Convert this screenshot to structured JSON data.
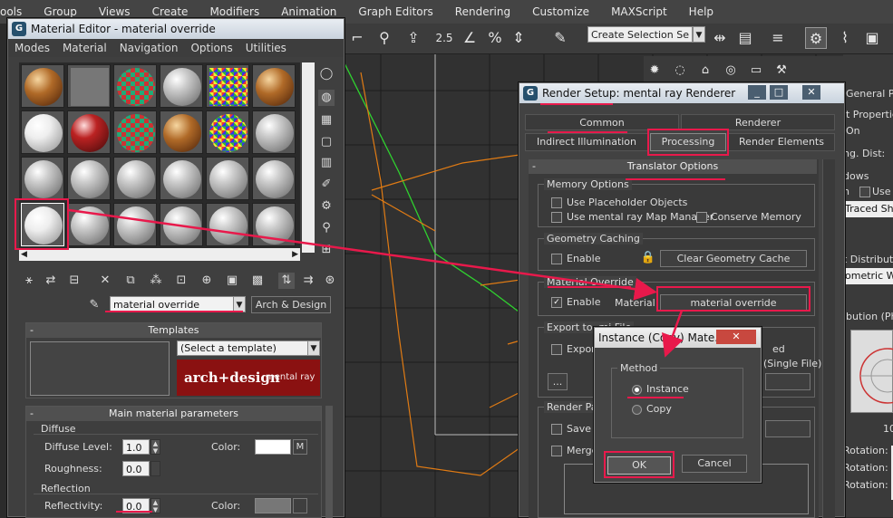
{
  "menubar": {
    "items": [
      "ools",
      "Group",
      "Views",
      "Create",
      "Modifiers",
      "Animation",
      "Graph Editors",
      "Rendering",
      "Customize",
      "MAXScript",
      "Help"
    ]
  },
  "toolbar": {
    "spinner_value": "2.5",
    "selection_set_placeholder": "Create Selection Se"
  },
  "material_editor": {
    "title": "Material Editor - material override",
    "menu": [
      "Modes",
      "Material",
      "Navigation",
      "Options",
      "Utilities"
    ],
    "material_name": "material override",
    "material_type": "Arch & Design",
    "templates": {
      "header": "Templates",
      "select": "(Select a template)",
      "logo_main": "arch+design",
      "logo_sub": "mental ray"
    },
    "main_params": {
      "header": "Main material parameters",
      "diffuse": {
        "title": "Diffuse",
        "level_label": "Diffuse Level:",
        "level_value": "1.0",
        "roughness_label": "Roughness:",
        "roughness_value": "0.0",
        "color_label": "Color:",
        "map_button": "M"
      },
      "reflection": {
        "title": "Reflection",
        "reflectivity_label": "Reflectivity:",
        "reflectivity_value": "0.0",
        "color_label": "Color:"
      }
    }
  },
  "render_setup": {
    "title": "Render Setup: mental ray Renderer",
    "tabs_row1": [
      "Common",
      "Renderer"
    ],
    "tabs_row2": [
      "Indirect Illumination",
      "Processing",
      "Render Elements"
    ],
    "rollout_title": "Translator Options",
    "memory_options": {
      "title": "Memory Options",
      "use_placeholder": "Use Placeholder Objects",
      "use_map_manager": "Use mental ray Map Manager",
      "conserve_memory": "Conserve Memory"
    },
    "geometry_caching": {
      "title": "Geometry Caching",
      "enable": "Enable",
      "clear_button": "Clear Geometry Cache"
    },
    "material_override": {
      "title": "Material Override",
      "enable": "Enable",
      "material_label": "Material",
      "material_button": "material override"
    },
    "export_mi": {
      "title": "Export to .mi File",
      "export_label": "Expor",
      "ed_label": "ed",
      "single_file": "(Single File)",
      "browse_button": "..."
    },
    "render_passes": {
      "title": "Render Pa",
      "save_label": "Save",
      "merge_label": "Merge"
    }
  },
  "instance_dialog": {
    "title": "Instance (Copy) Mate...",
    "method_title": "Method",
    "option_instance": "Instance",
    "option_copy": "Copy",
    "ok": "OK",
    "cancel": "Cancel"
  },
  "right_panel": {
    "labels": [
      "General Pa",
      "t Properties",
      "On",
      "ng. Dist:",
      "dows",
      "n",
      "Use C",
      "Traced Sha",
      "t Distributio",
      "ometric We",
      "ibution (Pho",
      "10",
      "Rotation:",
      "Rotation:",
      "Rotation:"
    ]
  },
  "colors": {
    "annotation": "#e8194b",
    "accent_green": "#2fd12f",
    "accent_orange": "#e07b14"
  }
}
